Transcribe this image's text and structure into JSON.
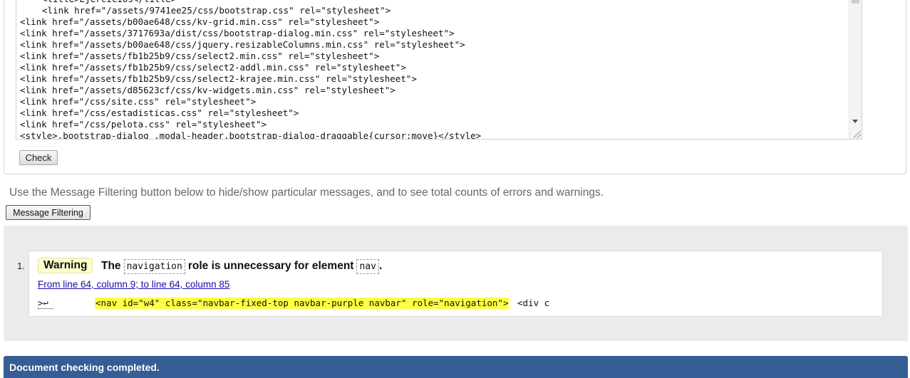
{
  "source": {
    "lines": [
      {
        "text": "<title>Ejercicios</title>",
        "indent": true
      },
      {
        "text": "<link href=\"/assets/9741ee25/css/bootstrap.css\" rel=\"stylesheet\">",
        "indent": true
      },
      {
        "text": "<link href=\"/assets/b00ae648/css/kv-grid.min.css\" rel=\"stylesheet\">",
        "indent": false
      },
      {
        "text": "<link href=\"/assets/3717693a/dist/css/bootstrap-dialog.min.css\" rel=\"stylesheet\">",
        "indent": false
      },
      {
        "text": "<link href=\"/assets/b00ae648/css/jquery.resizableColumns.min.css\" rel=\"stylesheet\">",
        "indent": false
      },
      {
        "text": "<link href=\"/assets/fb1b25b9/css/select2.min.css\" rel=\"stylesheet\">",
        "indent": false
      },
      {
        "text": "<link href=\"/assets/fb1b25b9/css/select2-addl.min.css\" rel=\"stylesheet\">",
        "indent": false
      },
      {
        "text": "<link href=\"/assets/fb1b25b9/css/select2-krajee.min.css\" rel=\"stylesheet\">",
        "indent": false
      },
      {
        "text": "<link href=\"/assets/d85623cf/css/kv-widgets.min.css\" rel=\"stylesheet\">",
        "indent": false
      },
      {
        "text": "<link href=\"/css/site.css\" rel=\"stylesheet\">",
        "indent": false
      },
      {
        "text": "<link href=\"/css/estadisticas.css\" rel=\"stylesheet\">",
        "indent": false
      },
      {
        "text": "<link href=\"/css/pelota.css\" rel=\"stylesheet\">",
        "indent": false
      },
      {
        "text": "<style>.bootstrap-dialog .modal-header.bootstrap-dialog-draggable{cursor:move}</style>",
        "indent": false
      }
    ]
  },
  "check_button": "Check",
  "help_text": "Use the Message Filtering button below to hide/show particular messages, and to see total counts of errors and warnings.",
  "filter_button": "Message Filtering",
  "message": {
    "number": "1.",
    "type": "Warning",
    "text_prefix": "The",
    "code_role": "navigation",
    "text_middle": "role is unnecessary for element",
    "code_element": "nav",
    "text_suffix": ".",
    "location": "From line 64, column 9; to line 64, column 85",
    "extract_prefix": ">↩",
    "extract_highlight": "<nav id=\"w4\" class=\"navbar-fixed-top navbar-purple navbar\" role=\"navigation\">",
    "extract_after": "<div c"
  },
  "status": "Document checking completed.",
  "colors": {
    "status_bar": "#365d95",
    "warning_badge": "#ffffcc",
    "highlight": "#ffff44",
    "link": "#1a0dab"
  }
}
